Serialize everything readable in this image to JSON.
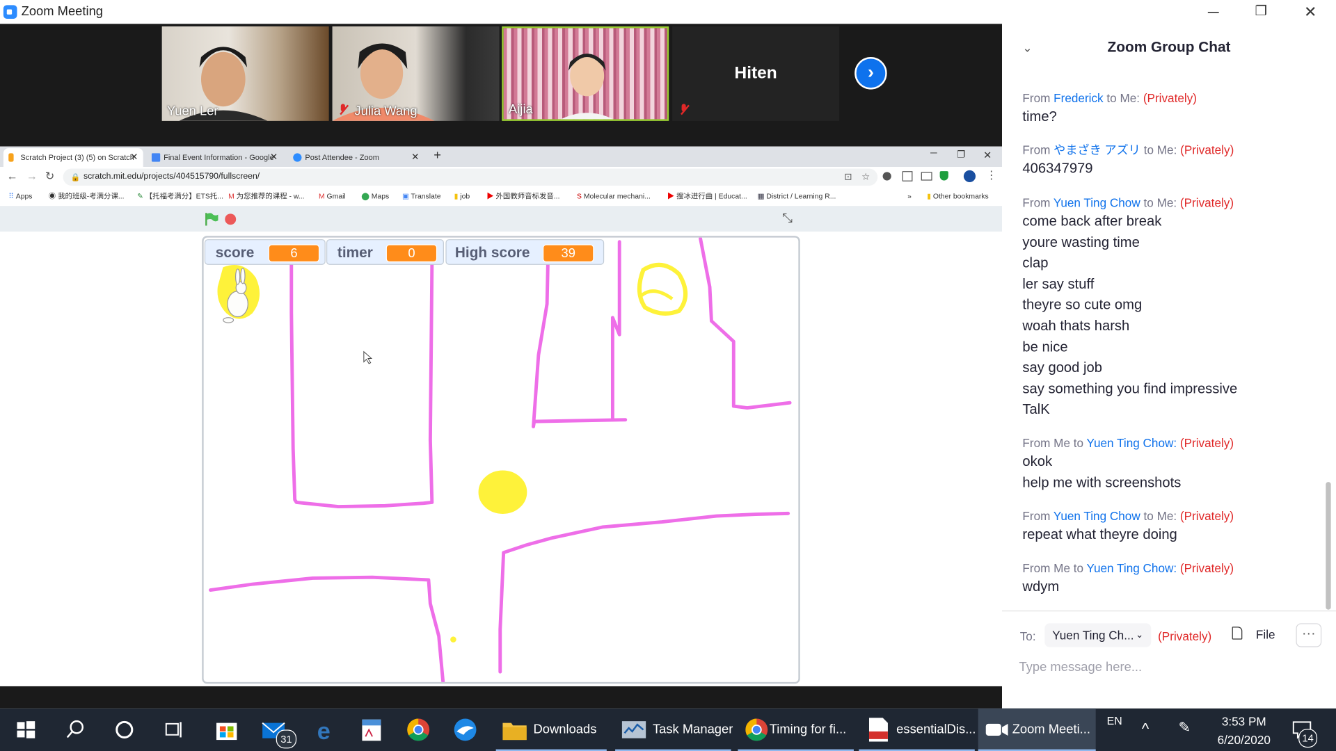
{
  "window": {
    "title": "Zoom Meeting"
  },
  "participants": [
    {
      "name": "Yuen Ler"
    },
    {
      "name": "Julia Wang"
    },
    {
      "name": "Aijia"
    },
    {
      "name": "Hiten"
    }
  ],
  "browser": {
    "tabs": [
      {
        "label": "Scratch Project (3) (5) on Scratch"
      },
      {
        "label": "Final Event Information - Google"
      },
      {
        "label": "Post Attendee - Zoom"
      }
    ],
    "url": "scratch.mit.edu/projects/404515790/fullscreen/",
    "bookmarks": [
      "Apps",
      "我的班级-考满分课...",
      "【托福考满分】ETS托...",
      "为您推荐的课程 - w...",
      "Gmail",
      "Maps",
      "Translate",
      "job",
      "外国教师音标发音...",
      "Molecular mechani...",
      "搜冰进行曲 | Educat...",
      "District / Learning R...",
      "Other bookmarks"
    ]
  },
  "scratch": {
    "monitors": [
      {
        "label": "score",
        "value": "6"
      },
      {
        "label": "timer",
        "value": "0"
      },
      {
        "label": "High score",
        "value": "39"
      }
    ]
  },
  "chat": {
    "title": "Zoom Group Chat",
    "messages": [
      {
        "from": "Frederick",
        "to": "Me",
        "priv": "(Privately)",
        "lines": [
          "time?"
        ]
      },
      {
        "from": "やまざき アズリ",
        "to": "Me",
        "priv": "(Privately)",
        "lines": [
          "406347979"
        ]
      },
      {
        "from": "Yuen Ting Chow",
        "to": "Me",
        "priv": "(Privately)",
        "lines": [
          "come back after break",
          "youre wasting time",
          "clap",
          "ler say stuff",
          "theyre so cute omg",
          "woah thats harsh",
          "be nice",
          "say good job",
          "say something you find impressive",
          "TalK"
        ]
      },
      {
        "from": "Me",
        "to": "Yuen Ting Chow:",
        "priv": "(Privately)",
        "lines": [
          "okok",
          "help me with screenshots"
        ]
      },
      {
        "from": "Yuen Ting Chow",
        "to": "Me",
        "priv": "(Privately)",
        "lines": [
          "repeat what theyre doing"
        ]
      },
      {
        "from": "Me",
        "to": "Yuen Ting Chow:",
        "priv": "(Privately)",
        "lines": [
          "wdym"
        ]
      }
    ],
    "to_label": "To:",
    "to_value": "Yuen Ting Ch...",
    "to_priv": "(Privately)",
    "file_label": "File",
    "more_label": "···",
    "placeholder": "Type message here..."
  },
  "taskbar": {
    "apps": [
      {
        "label": "Downloads"
      },
      {
        "label": "Task Manager"
      },
      {
        "label": "Timing for fi..."
      },
      {
        "label": "essentialDis..."
      },
      {
        "label": "Zoom Meeti..."
      }
    ],
    "mail_badge": "31",
    "lang": "EN",
    "time": "3:53 PM",
    "date": "6/20/2020",
    "notif_count": "14"
  }
}
